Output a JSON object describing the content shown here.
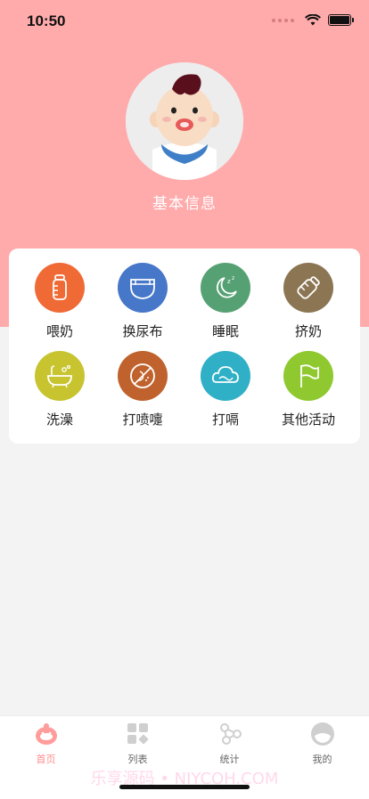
{
  "status_bar": {
    "time": "10:50"
  },
  "profile": {
    "title": "基本信息"
  },
  "activities": [
    {
      "label": "喂奶",
      "icon": "bottle-icon",
      "color": "#f06a36"
    },
    {
      "label": "换尿布",
      "icon": "diaper-icon",
      "color": "#4677c8"
    },
    {
      "label": "睡眠",
      "icon": "moon-sleep-icon",
      "color": "#56a174"
    },
    {
      "label": "挤奶",
      "icon": "breast-pump-icon",
      "color": "#8b7553"
    },
    {
      "label": "洗澡",
      "icon": "bathtub-icon",
      "color": "#c7c42f"
    },
    {
      "label": "打喷嚏",
      "icon": "sneeze-icon",
      "color": "#c0622d"
    },
    {
      "label": "打嗝",
      "icon": "burp-cloud-icon",
      "color": "#2fb0c6"
    },
    {
      "label": "其他活动",
      "icon": "flag-icon",
      "color": "#8fc92f"
    }
  ],
  "tabs": [
    {
      "label": "首页",
      "icon": "home-baby-icon",
      "active": true
    },
    {
      "label": "列表",
      "icon": "grid-list-icon",
      "active": false
    },
    {
      "label": "统计",
      "icon": "share-nodes-icon",
      "active": false
    },
    {
      "label": "我的",
      "icon": "profile-icon",
      "active": false
    }
  ],
  "colors": {
    "header": "#ffabab",
    "active_tab": "#ff8c8c"
  },
  "watermark": "乐享源码 • NIYCOH.COM"
}
